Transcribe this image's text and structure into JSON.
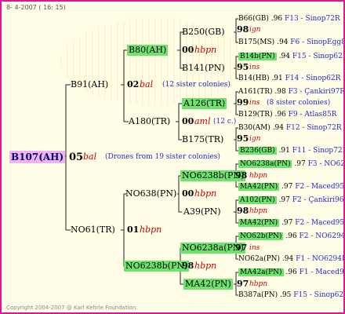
{
  "header": "8- 4-2007 ( 16: 15)",
  "footer": "Copyright 2004-2007 @ Karl Kehrle Foundation.",
  "root": {
    "name": "B107(AH)",
    "num": "05",
    "mark": "bal",
    "note": "(Drones from 19 sister colonies)"
  },
  "dam": {
    "name": "B91(AH)",
    "num": "02",
    "mark": "bal",
    "note": "(12 sister colonies)"
  },
  "sire": {
    "name": "NO61(TR)",
    "num": "01",
    "mark": "hbpn"
  },
  "dd": {
    "name": "B80(AH)",
    "num": "00",
    "mark": "hbpn"
  },
  "ds": {
    "name": "A180(TR)",
    "num": "00",
    "mark": "aml",
    "note": "(12 c.)"
  },
  "sd": {
    "name": "NO638(PN)",
    "num": "00",
    "mark": "hbpn"
  },
  "ss": {
    "name": "NO6238b(PN)",
    "num": "98",
    "mark": "hbpn"
  },
  "l3": [
    {
      "name": "B250(GB)"
    },
    {
      "name": "B141(PN)"
    },
    {
      "name": "A126(TR)",
      "num": "99",
      "mark": "ins",
      "note": "(8 sister colonies)"
    },
    {
      "name": "B175(TR)",
      "num": "95",
      "mark": "ign"
    },
    {
      "name": "NO6238b(PN)",
      "num": "98",
      "mark": "hbpn"
    },
    {
      "name": "A39(PN)",
      "num": "98",
      "mark": "hbpn"
    },
    {
      "name": "NO6238a(PN)",
      "num": "97",
      "mark": "ins"
    },
    {
      "name": "MA42(PN)",
      "num": "97",
      "mark": "hbpn"
    }
  ],
  "l4": [
    {
      "name": "B66(GB)",
      "val": ".96",
      "src": "F13 - Sinop72R",
      "num": "98",
      "mark": "ign"
    },
    {
      "name": "B175(MS)",
      "val": ".94",
      "src": "F6 - SinopEgg86R"
    },
    {
      "name": "B14b(PN)",
      "val": ".94",
      "src": "F15 - Sinop62R",
      "num": "95",
      "mark": "ins"
    },
    {
      "name": "B14(HB)",
      "val": ".91",
      "src": "F14 - Sinop62R"
    },
    {
      "name": "A161(TR)",
      "val": ".98",
      "src": "F3 - Çankiri97R"
    },
    {
      "name": "B129(TR)",
      "val": ".96",
      "src": "F9 - Atlas85R"
    },
    {
      "name": "B30(AM)",
      "val": ".94",
      "src": "F12 - Sinop72R"
    },
    {
      "name": "B236(GB)",
      "val": ".91",
      "src": "F11 - Sinop72R"
    },
    {
      "name": "NO6238a(PN)",
      "val": ".97",
      "src": "F3 - NO6294R",
      "num": "97",
      "mark": "hbpn"
    },
    {
      "name": "MA42(PN)",
      "val": ".97",
      "src": "F2 - Maced95R"
    },
    {
      "name": "A102(PN)",
      "val": ".97",
      "src": "F2 - Çankiri96R",
      "num": "98",
      "mark": "hbpn"
    },
    {
      "name": "MA42(PN)",
      "val": ".97",
      "src": "F2 - Maced95R"
    },
    {
      "name": "NO62b(PN)",
      "val": ".96",
      "src": "F2 - NO6294R"
    },
    {
      "name": "NO62a(PN)",
      "val": ".94",
      "src": "F1 - NO6294R"
    },
    {
      "name": "MA42a(PN)",
      "val": ".96",
      "src": "F1 - Maced95R"
    },
    {
      "name": "B387a(PN)",
      "val": ".95",
      "src": "F15 - Sinop62R"
    }
  ],
  "colors": {
    "border": "#e0149a",
    "bg": "#fffde6",
    "highlight": "#6ee36e",
    "root": "#f0b4f0",
    "red": "#cc0000",
    "blue": "#2828c8"
  }
}
